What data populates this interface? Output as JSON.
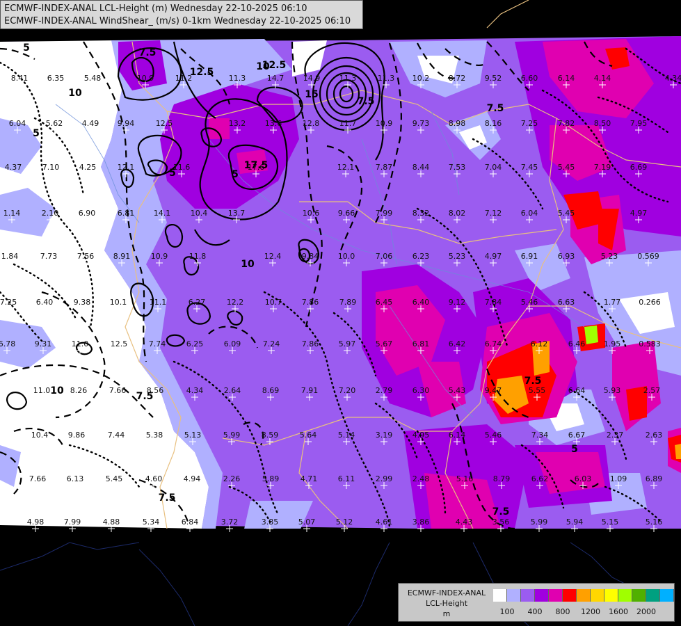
{
  "header": {
    "line1": "ECMWF-INDEX-ANAL LCL-Height (m) Wednesday 22-10-2025 06:10",
    "line2": "ECMWF-INDEX-ANAL WindShear_ (m/s) 0-1km Wednesday 22-10-2025 06:10"
  },
  "legend": {
    "label_lines": [
      "ECMWF-INDEX-ANAL",
      "LCL-Height",
      "m"
    ],
    "colors": [
      "#ffffff",
      "#b0b0ff",
      "#9b5cf0",
      "#a000e0",
      "#e000b0",
      "#ff0000",
      "#ffa000",
      "#ffd700",
      "#ffff00",
      "#a0ff00",
      "#50b000",
      "#00a080",
      "#00b0ff"
    ],
    "ticks": [
      "100",
      "400",
      "800",
      "1200",
      "1600",
      "2000"
    ]
  },
  "contour_labels": [
    {
      "text": "5"
    },
    {
      "text": "7.5"
    },
    {
      "text": "10"
    },
    {
      "text": "12.5"
    },
    {
      "text": "15"
    },
    {
      "text": "17.5"
    },
    {
      "text": "7.5"
    },
    {
      "text": "5"
    },
    {
      "text": "10"
    },
    {
      "text": "7.5"
    },
    {
      "text": "5"
    },
    {
      "text": "7.5"
    },
    {
      "text": "5"
    },
    {
      "text": "7.5"
    },
    {
      "text": "10"
    },
    {
      "text": "10"
    },
    {
      "text": "12.5"
    },
    {
      "text": "7.5"
    },
    {
      "text": "5"
    },
    {
      "text": "7.5"
    }
  ],
  "station_values": [
    "8.41",
    "6.35",
    "5.48",
    "10.9",
    "11.2",
    "11.3",
    "14.7",
    "14.9",
    "11.3",
    "11.3",
    "10.2",
    "8.72",
    "9.52",
    "6.60",
    "6.14",
    "4.14",
    "4.34",
    "6.04",
    "5.62",
    "4.49",
    "9.94",
    "12.5",
    "13.2",
    "13.6",
    "12.8",
    "11.7",
    "10.9",
    "9.73",
    "8.98",
    "8.16",
    "7.25",
    "7.82",
    "8.50",
    "7.95",
    "4.37",
    "7.10",
    "4.25",
    "12.1",
    "11.6",
    "17.6",
    "12.1",
    "7.87",
    "8.44",
    "7.53",
    "7.04",
    "7.45",
    "5.45",
    "7.19",
    "6.69",
    "1.14",
    "2.10",
    "6.90",
    "6.81",
    "14.1",
    "10.4",
    "13.7",
    "10.6",
    "9.66",
    "7.99",
    "8.32",
    "8.02",
    "7.12",
    "6.04",
    "5.45",
    "4.97",
    "1.84",
    "7.73",
    "7.56",
    "8.91",
    "10.9",
    "11.8",
    "12.4",
    "9.84",
    "10.0",
    "7.06",
    "6.23",
    "5.23",
    "4.97",
    "6.91",
    "6.93",
    "5.23",
    "0.569",
    "7.25",
    "6.40",
    "9.38",
    "10.1",
    "11.1",
    "6.27",
    "12.2",
    "10.7",
    "7.86",
    "7.89",
    "6.45",
    "6.40",
    "9.12",
    "7.84",
    "5.46",
    "6.63",
    "1.77",
    "0.266",
    "6.78",
    "9.31",
    "11.0",
    "12.5",
    "7.74",
    "6.25",
    "6.09",
    "7.24",
    "7.86",
    "5.97",
    "5.67",
    "6.81",
    "6.42",
    "6.74",
    "6.12",
    "6.46",
    "1.95",
    "0.583",
    "11.0",
    "8.26",
    "7.66",
    "8.56",
    "4.34",
    "2.64",
    "8.69",
    "7.91",
    "7.20",
    "2.79",
    "6.30",
    "5.43",
    "9.47",
    "5.55",
    "6.64",
    "5.93",
    "2.57",
    "10.4",
    "9.86",
    "7.44",
    "5.38",
    "5.13",
    "5.99",
    "8.59",
    "5.64",
    "5.14",
    "3.19",
    "4.95",
    "6.14",
    "5.46",
    "7.34",
    "6.67",
    "2.37",
    "2.63",
    "7.66",
    "6.13",
    "5.45",
    "4.60",
    "4.94",
    "2.26",
    "5.89",
    "4.71",
    "6.11",
    "2.99",
    "2.48",
    "5.16",
    "8.79",
    "6.62",
    "6.03",
    "1.09",
    "6.89",
    "4.98",
    "7.99",
    "4.88",
    "5.34",
    "6.84",
    "3.72",
    "3.85",
    "5.07",
    "5.12",
    "4.61",
    "3.86",
    "4.43",
    "3.56",
    "5.99",
    "5.94",
    "5.15",
    "5.16"
  ]
}
